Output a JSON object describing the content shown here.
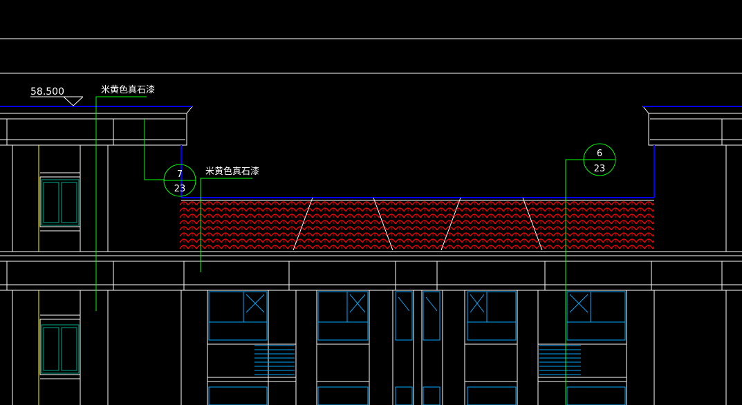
{
  "drawing": {
    "elevation_label": "58.500",
    "material_note_1": "米黄色真石漆",
    "material_note_2": "米黄色真石漆",
    "detail_callout_left": {
      "number": "7",
      "sheet": "23"
    },
    "detail_callout_right": {
      "number": "6",
      "sheet": "23"
    }
  },
  "colors": {
    "background": "#000000",
    "lines": "#ffffff",
    "leaders": "#00ff00",
    "outline_blue": "#0000ff",
    "window_frames": "#00aaff",
    "tile_hatch": "#ff0000",
    "pilaster": "#ffff00"
  }
}
